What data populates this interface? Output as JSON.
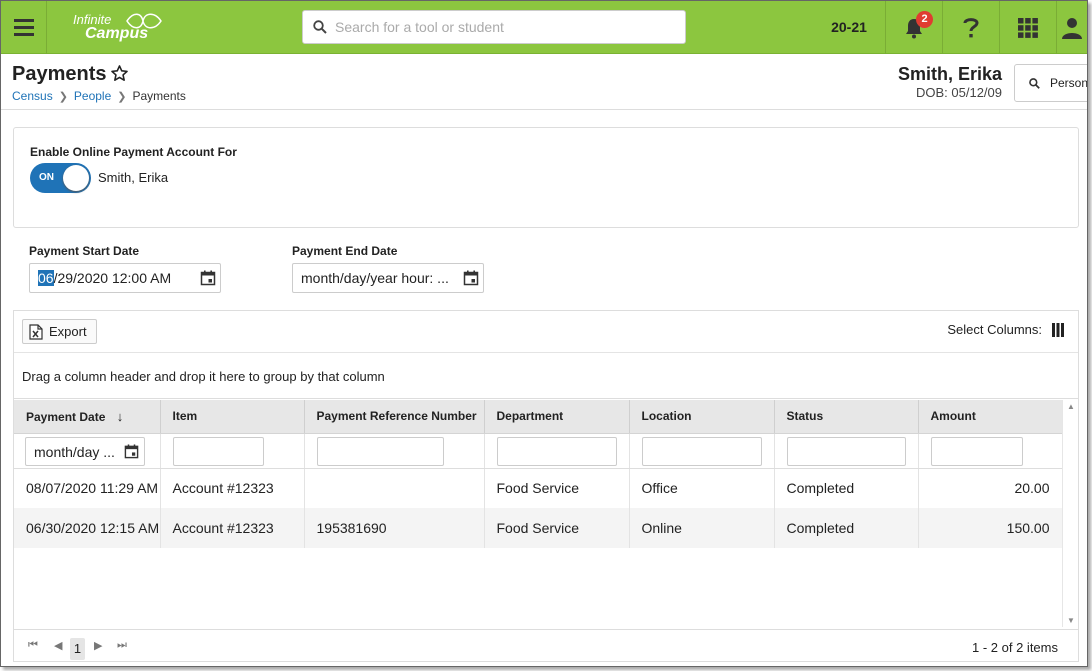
{
  "topbar": {
    "logo_line1": "Infinite",
    "logo_line2": "Campus",
    "search_placeholder": "Search for a tool or student",
    "year": "20-21",
    "notification_count": "2",
    "accent_color": "#8cc63f"
  },
  "header": {
    "title": "Payments",
    "breadcrumb": [
      "Census",
      "People",
      "Payments"
    ],
    "person_name": "Smith, Erika",
    "person_dob": "DOB: 05/12/09",
    "person_button_label": "Person"
  },
  "online_payment": {
    "label": "Enable Online Payment Account For",
    "toggle_state": "ON",
    "person": "Smith, Erika"
  },
  "date_filters": {
    "start_label": "Payment Start Date",
    "start_value_selected": "06",
    "start_value_rest": "/29/2020 12:00 AM",
    "end_label": "Payment End Date",
    "end_value": "month/day/year hour: ..."
  },
  "grid": {
    "export_label": "Export",
    "select_columns_label": "Select Columns:",
    "group_hint": "Drag a column header and drop it here to group by that column",
    "columns": [
      "Payment Date",
      "Item",
      "Payment Reference Number",
      "Department",
      "Location",
      "Status",
      "Amount"
    ],
    "date_filter_placeholder": "month/day ...",
    "rows": [
      {
        "date": "08/07/2020 11:29 AM",
        "item": "Account #12323",
        "reference": "",
        "department": "Food Service",
        "location": "Office",
        "status": "Completed",
        "amount": "20.00"
      },
      {
        "date": "06/30/2020 12:15 AM",
        "item": "Account #12323",
        "reference": "195381690",
        "department": "Food Service",
        "location": "Online",
        "status": "Completed",
        "amount": "150.00"
      }
    ],
    "current_page": "1",
    "page_info": "1 - 2 of 2 items"
  }
}
